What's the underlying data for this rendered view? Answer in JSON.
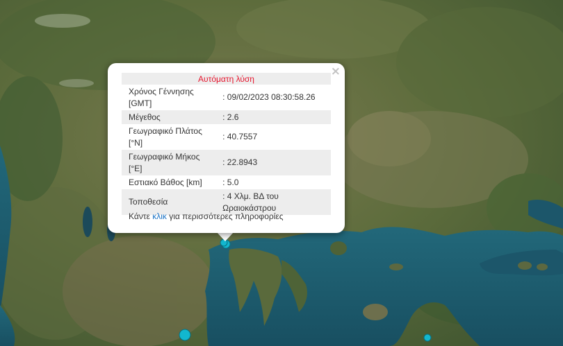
{
  "popup": {
    "title": "Αυτόματη λύση",
    "close_symbol": "×",
    "rows": [
      {
        "label": "Χρόνος Γέννησης [GMT]",
        "value": ": 09/02/2023 08:30:58.26"
      },
      {
        "label": "Μέγεθος",
        "value": ": 2.6"
      },
      {
        "label": "Γεωγραφικό Πλάτος [°N]",
        "value": ": 40.7557"
      },
      {
        "label": "Γεωγραφικό Μήκος [°E]",
        "value": ": 22.8943"
      },
      {
        "label": "Εστιακό Βάθος [km]",
        "value": ": 5.0"
      },
      {
        "label": "Τοποθεσία",
        "value": ": 4 Χλμ. ΒΔ του Ωραιοκάστρου"
      }
    ],
    "more_prefix": "Κάντε ",
    "more_link": "κλικ",
    "more_suffix": " για περισσότερες πληροφορίες"
  },
  "colors": {
    "sea": "#1e5f72",
    "land": "#5b6d3e",
    "marker": "#12b7cf",
    "title_red": "#e6162e",
    "link_blue": "#1a73c6"
  }
}
